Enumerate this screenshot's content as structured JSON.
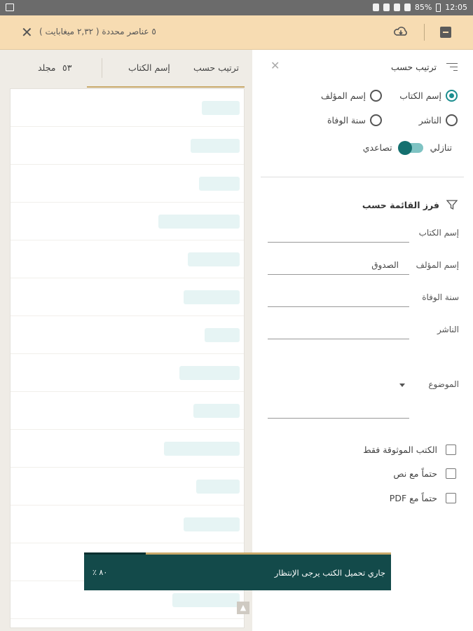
{
  "status_bar": {
    "battery": "85%",
    "time": "12:05"
  },
  "top_bar": {
    "selection_text": "٥ عناصر محددة ( ٢,٣٢ ميغابايت )"
  },
  "tabs": {
    "sort_by": "ترتيب حسب",
    "book_name": "إسم الكتاب",
    "volume_count": "٥٣",
    "volume_label": "مجلد"
  },
  "sort_panel": {
    "title": "ترتيب حسب",
    "options": [
      {
        "label": "إسم الكتاب",
        "selected": true
      },
      {
        "label": "إسم المؤلف",
        "selected": false
      },
      {
        "label": "الناشر",
        "selected": false
      },
      {
        "label": "سنة الوفاة",
        "selected": false
      }
    ],
    "descending_label": "تنازلي",
    "ascending_label": "تصاعدي",
    "toggle_state": "تصاعدي"
  },
  "filter_panel": {
    "title": "فرز القائمة حسب",
    "fields": [
      {
        "label": "إسم الكتاب",
        "value": ""
      },
      {
        "label": "إسم المؤلف",
        "value": "الصدوق"
      },
      {
        "label": "سنة الوفاة",
        "value": ""
      },
      {
        "label": "الناشر",
        "value": ""
      }
    ],
    "topic_label": "الموضوع",
    "checkboxes": [
      {
        "label": "الكتب الموثوقة فقط",
        "checked": false
      },
      {
        "label": "حتماً مع نص",
        "checked": false
      },
      {
        "label": "حتماً مع PDF",
        "checked": false
      }
    ]
  },
  "toast": {
    "message": "جاري تحميل الكتب يرجى الإنتظار",
    "percent_text": "٨٠ ٪",
    "progress": 0.2
  },
  "colors": {
    "accent": "#1c8e8f",
    "topbar": "#f7dcb2",
    "toast": "#134a4a",
    "gold": "#c9a96b"
  }
}
